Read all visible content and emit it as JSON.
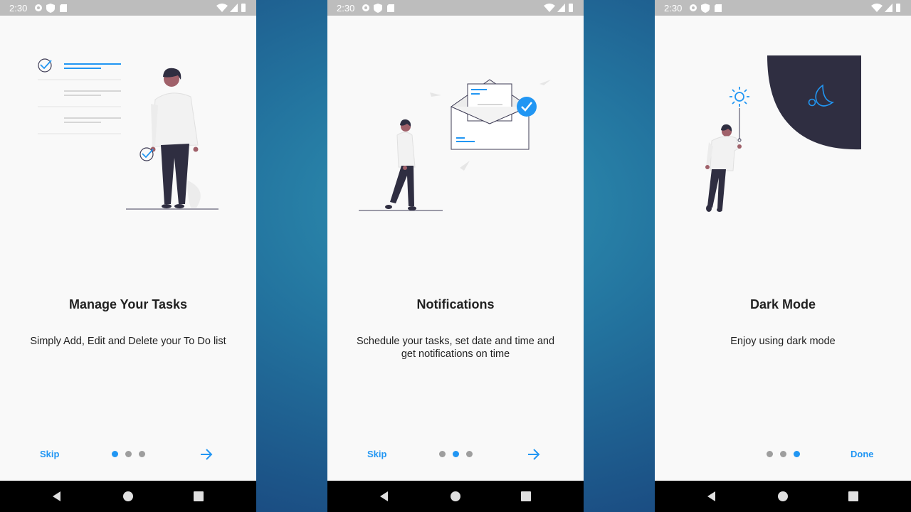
{
  "screens": [
    {
      "status_time": "2:30",
      "title": "Manage Your Tasks",
      "description": "Simply Add, Edit and Delete your To Do list",
      "skip_label": "Skip",
      "active_dot": 0
    },
    {
      "status_time": "2:30",
      "title": "Notifications",
      "description": "Schedule your tasks, set date and time and get notifications on time",
      "skip_label": "Skip",
      "active_dot": 1
    },
    {
      "status_time": "2:30",
      "title": "Dark Mode",
      "description": "Enjoy using dark mode",
      "done_label": "Done",
      "active_dot": 2
    }
  ],
  "status_icons": [
    "settings-icon",
    "shield-icon",
    "sd-card-icon",
    "wifi-icon",
    "signal-icon",
    "battery-icon"
  ],
  "nav_buttons": [
    "back-button",
    "home-button",
    "recents-button"
  ],
  "colors": {
    "accent": "#2196f3",
    "dot_inactive": "#9e9e9e",
    "dark_panel": "#2f2e41",
    "status_bar": "#bdbdbd",
    "screen_bg": "#f9f9f9"
  }
}
